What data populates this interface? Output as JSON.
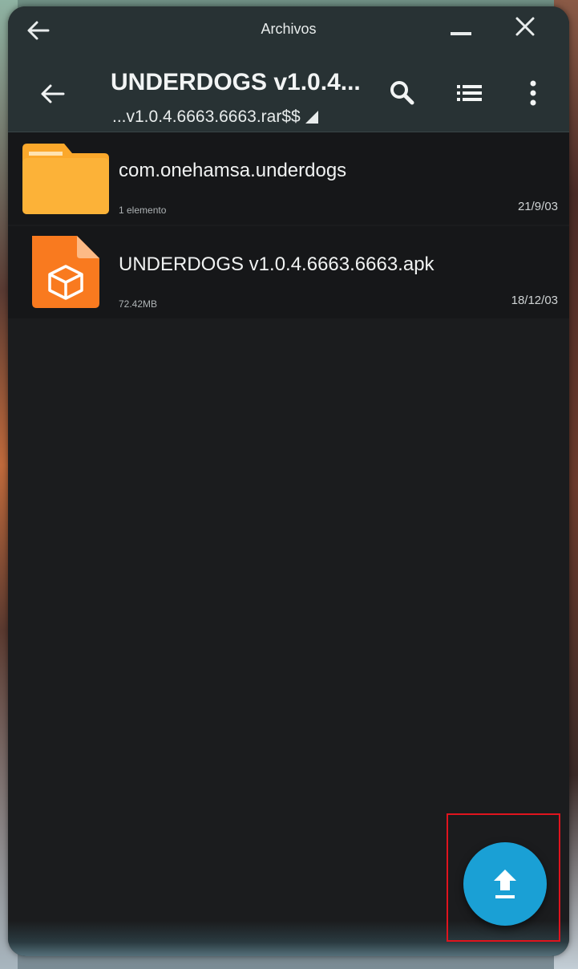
{
  "titlebar": {
    "title": "Archivos"
  },
  "toolbar": {
    "title": "UNDERDOGS v1.0.4...",
    "subtitle": "...v1.0.4.6663.6663.rar$$"
  },
  "files": [
    {
      "name": "com.onehamsa.underdogs",
      "meta": "1 elemento",
      "date": "21/9/03",
      "icon": "folder-icon"
    },
    {
      "name": "UNDERDOGS v1.0.4.6663.6663.apk",
      "meta": "72.42MB",
      "date": "18/12/03",
      "icon": "apk-package-icon"
    }
  ],
  "fab": {
    "icon": "upload-icon"
  },
  "colors": {
    "toolbar": "#283234",
    "list_background": "#161719",
    "folder": "#fba82b",
    "apk": "#f97a1f",
    "fab": "#1aa0d5",
    "highlight": "#e0141e"
  }
}
